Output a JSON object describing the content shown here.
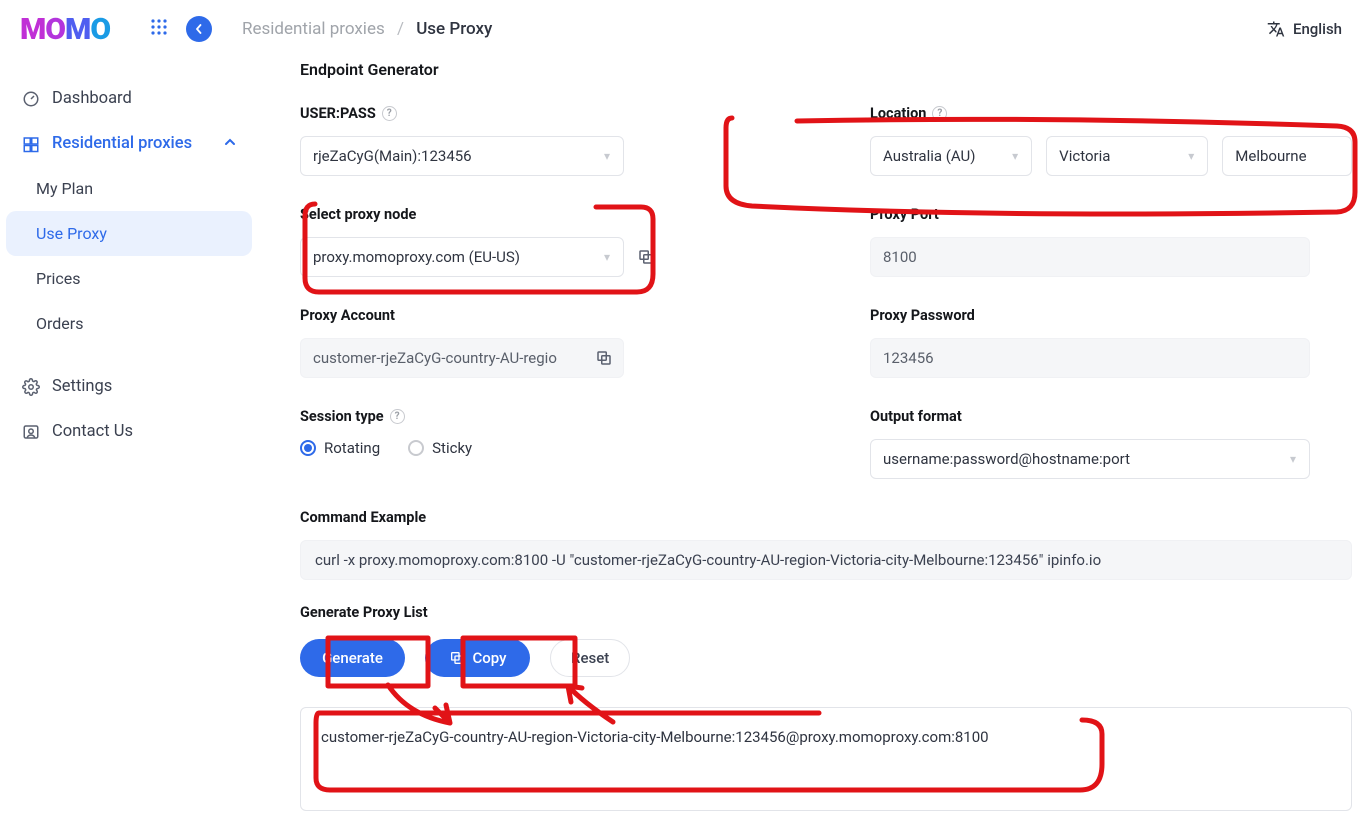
{
  "logo": {
    "m1": "M",
    "o1": "O",
    "m2": "M",
    "o2": "O"
  },
  "lang": "English",
  "breadcrumb": {
    "parent": "Residential proxies",
    "current": "Use Proxy"
  },
  "sidebar": {
    "dashboard": "Dashboard",
    "residential": "Residential proxies",
    "my_plan": "My Plan",
    "use_proxy": "Use Proxy",
    "prices": "Prices",
    "orders": "Orders",
    "settings": "Settings",
    "contact": "Contact Us"
  },
  "main": {
    "section_title": "Endpoint Generator",
    "user_pass_label": "USER:PASS",
    "user_pass_value": "rjeZaCyG(Main):123456",
    "location_label": "Location",
    "location_country": "Australia (AU)",
    "location_region": "Victoria",
    "location_city": "Melbourne",
    "node_label": "Select proxy node",
    "node_value": "proxy.momoproxy.com (EU-US)",
    "port_label": "Proxy Port",
    "port_value": "8100",
    "account_label": "Proxy Account",
    "account_value": "customer-rjeZaCyG-country-AU-regio",
    "password_label": "Proxy Password",
    "password_value": "123456",
    "session_label": "Session type",
    "session_rotating": "Rotating",
    "session_sticky": "Sticky",
    "output_label": "Output format",
    "output_value": "username:password@hostname:port",
    "cmd_label": "Command Example",
    "cmd_value": "curl -x proxy.momoproxy.com:8100 -U \"customer-rjeZaCyG-country-AU-region-Victoria-city-Melbourne:123456\" ipinfo.io",
    "gen_label": "Generate Proxy List",
    "btn_generate": "Generate",
    "btn_copy": "Copy",
    "btn_reset": "Reset",
    "result": "customer-rjeZaCyG-country-AU-region-Victoria-city-Melbourne:123456@proxy.momoproxy.com:8100"
  }
}
